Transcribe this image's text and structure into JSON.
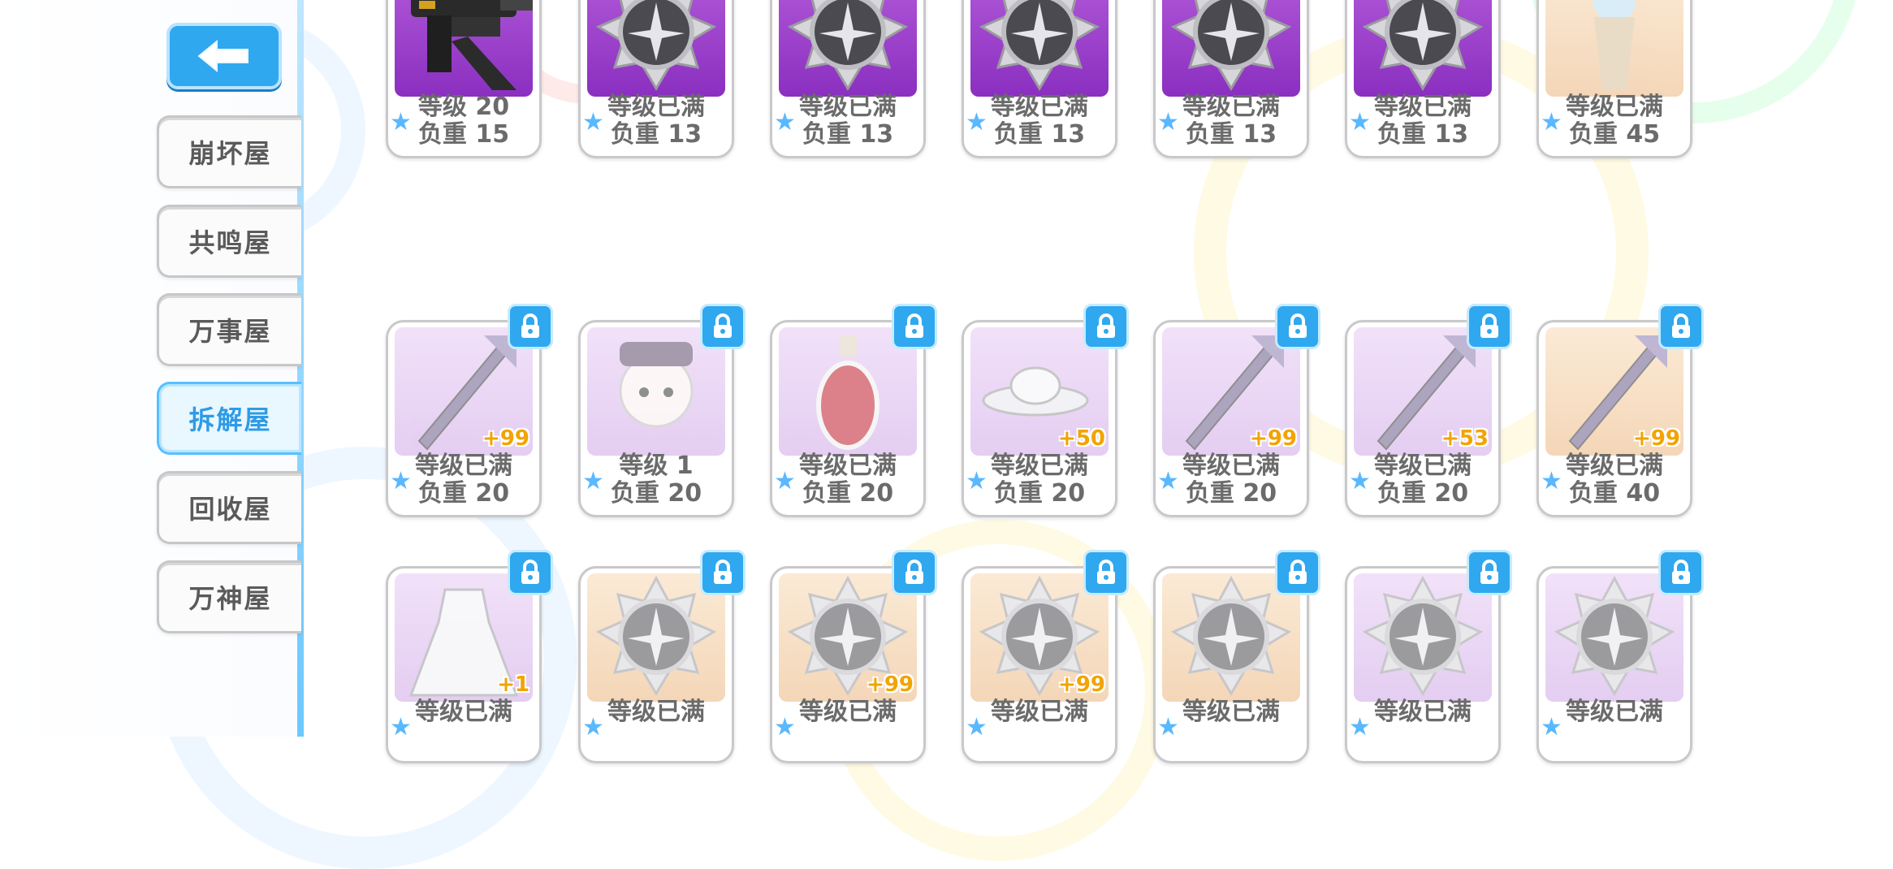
{
  "nav": {
    "back_icon": "back-arrow-icon",
    "items": [
      {
        "label": "崩坏屋",
        "active": false
      },
      {
        "label": "共鸣屋",
        "active": false
      },
      {
        "label": "万事屋",
        "active": false
      },
      {
        "label": "拆解屋",
        "active": true
      },
      {
        "label": "回收屋",
        "active": false
      },
      {
        "label": "万神屋",
        "active": false
      }
    ]
  },
  "items": [
    {
      "icon": "gun-icon",
      "bg": "purple",
      "level": "等级 20",
      "weight": "负重 15",
      "plus": "",
      "locked": false
    },
    {
      "icon": "stigmata-medal-icon",
      "bg": "purple",
      "level": "等级已满",
      "weight": "负重 13",
      "plus": "",
      "locked": false
    },
    {
      "icon": "stigmata-medal-icon",
      "bg": "purple",
      "level": "等级已满",
      "weight": "负重 13",
      "plus": "",
      "locked": false
    },
    {
      "icon": "stigmata-medal-icon",
      "bg": "purple",
      "level": "等级已满",
      "weight": "负重 13",
      "plus": "",
      "locked": false
    },
    {
      "icon": "stigmata-medal-icon",
      "bg": "purple",
      "level": "等级已满",
      "weight": "负重 13",
      "plus": "",
      "locked": false
    },
    {
      "icon": "stigmata-medal-icon",
      "bg": "purple",
      "level": "等级已满",
      "weight": "负重 13",
      "plus": "",
      "locked": false
    },
    {
      "icon": "relic-icon",
      "bg": "orange",
      "level": "等级已满",
      "weight": "负重 45",
      "plus": "",
      "locked": true
    },
    {
      "icon": "spear-icon",
      "bg": "lilac",
      "level": "等级已满",
      "weight": "负重 20",
      "plus": "+99",
      "locked": true
    },
    {
      "icon": "chibi-character-icon",
      "bg": "lilac",
      "level": "等级 1",
      "weight": "负重 20",
      "plus": "",
      "locked": true
    },
    {
      "icon": "potion-icon",
      "bg": "lilac",
      "level": "等级已满",
      "weight": "负重 20",
      "plus": "",
      "locked": true
    },
    {
      "icon": "ufo-icon",
      "bg": "lilac",
      "level": "等级已满",
      "weight": "负重 20",
      "plus": "+50",
      "locked": true
    },
    {
      "icon": "scythe-icon",
      "bg": "lilac",
      "level": "等级已满",
      "weight": "负重 20",
      "plus": "+99",
      "locked": true
    },
    {
      "icon": "crystal-lance-icon",
      "bg": "lilac",
      "level": "等级已满",
      "weight": "负重 20",
      "plus": "+53",
      "locked": true
    },
    {
      "icon": "mech-weapon-icon",
      "bg": "orange",
      "level": "等级已满",
      "weight": "负重 40",
      "plus": "+99",
      "locked": true
    },
    {
      "icon": "dress-icon",
      "bg": "lilac",
      "level": "等级已满",
      "weight": "",
      "plus": "+1",
      "locked": true
    },
    {
      "icon": "stigmata-medal-icon",
      "bg": "orange",
      "level": "等级已满",
      "weight": "",
      "plus": "",
      "locked": true
    },
    {
      "icon": "stigmata-medal-icon",
      "bg": "orange",
      "level": "等级已满",
      "weight": "",
      "plus": "+99",
      "locked": true
    },
    {
      "icon": "stigmata-medal-icon",
      "bg": "orange",
      "level": "等级已满",
      "weight": "",
      "plus": "+99",
      "locked": true
    },
    {
      "icon": "stigmata-medal-icon",
      "bg": "orange",
      "level": "等级已满",
      "weight": "",
      "plus": "",
      "locked": true
    },
    {
      "icon": "stigmata-medal-icon",
      "bg": "lilac",
      "level": "等级已满",
      "weight": "",
      "plus": "",
      "locked": true
    },
    {
      "icon": "stigmata-medal-icon",
      "bg": "lilac",
      "level": "等级已满",
      "weight": "",
      "plus": "",
      "locked": true
    }
  ],
  "colors": {
    "accent": "#2fa8ef",
    "plus": "#f2a400",
    "text": "#6b6b6b"
  }
}
